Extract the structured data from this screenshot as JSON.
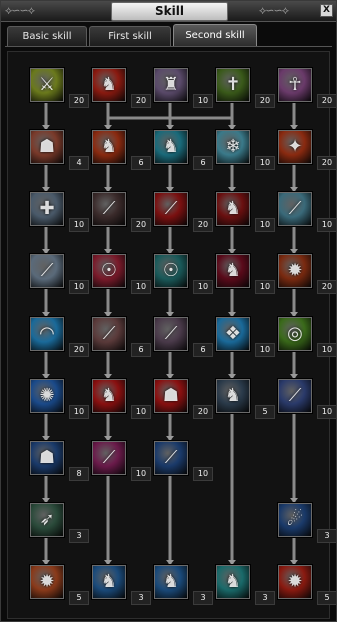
{
  "window": {
    "title": "Skill",
    "close_label": "X"
  },
  "tabs": [
    {
      "label": "Basic skill",
      "active": false
    },
    {
      "label": "First skill",
      "active": false
    },
    {
      "label": "Second skill",
      "active": true
    }
  ],
  "skills": [
    {
      "id": "r1c1",
      "level": "20",
      "icon": "golden-sword-icon",
      "color": "#6b7a1c"
    },
    {
      "id": "r1c2",
      "level": "20",
      "icon": "red-beast-icon",
      "color": "#8a1a10"
    },
    {
      "id": "r1c3",
      "level": "10",
      "icon": "armored-knight-icon",
      "color": "#5a4a6a"
    },
    {
      "id": "r1c4",
      "level": "20",
      "icon": "holy-cross-icon",
      "color": "#3a5a1a"
    },
    {
      "id": "r1c5",
      "level": "20",
      "icon": "robed-priest-icon",
      "color": "#6a3a6a"
    },
    {
      "id": "r2c1",
      "level": "4",
      "icon": "flesh-golem-icon",
      "color": "#7a3a2a"
    },
    {
      "id": "r2c2",
      "level": "6",
      "icon": "dragon-head-icon",
      "color": "#8a2a10"
    },
    {
      "id": "r2c3",
      "level": "6",
      "icon": "teal-wolf-icon",
      "color": "#1a6a7a"
    },
    {
      "id": "r2c4",
      "level": "10",
      "icon": "ice-beast-icon",
      "color": "#3a7a8a"
    },
    {
      "id": "r2c5",
      "level": "20",
      "icon": "flame-wing-icon",
      "color": "#8a2a10"
    },
    {
      "id": "r3c1",
      "level": "10",
      "icon": "cross-blade-icon",
      "color": "#4a5a6a"
    },
    {
      "id": "r3c2",
      "level": "20",
      "icon": "dark-claw-icon",
      "color": "#3a2a2a"
    },
    {
      "id": "r3c3",
      "level": "20",
      "icon": "red-claw-icon",
      "color": "#7a1010"
    },
    {
      "id": "r3c4",
      "level": "10",
      "icon": "red-beast-icon",
      "color": "#6a1010"
    },
    {
      "id": "r3c5",
      "level": "10",
      "icon": "ice-claw-icon",
      "color": "#3a6a7a"
    },
    {
      "id": "r4c1",
      "level": "10",
      "icon": "steel-blade-icon",
      "color": "#5a6a7a"
    },
    {
      "id": "r4c2",
      "level": "10",
      "icon": "fire-spirit-icon",
      "color": "#7a1a2a"
    },
    {
      "id": "r4c3",
      "level": "10",
      "icon": "teal-spirit-icon",
      "color": "#1a5a5a"
    },
    {
      "id": "r4c4",
      "level": "10",
      "icon": "crimson-wolf-icon",
      "color": "#5a0a1a"
    },
    {
      "id": "r4c5",
      "level": "20",
      "icon": "fire-dragon-icon",
      "color": "#7a2a10"
    },
    {
      "id": "r5c1",
      "level": "20",
      "icon": "blue-arc-icon",
      "color": "#1a6a9a"
    },
    {
      "id": "r5c2",
      "level": "6",
      "icon": "crimson-claw-icon",
      "color": "#5a3a3a"
    },
    {
      "id": "r5c3",
      "level": "6",
      "icon": "azure-claw-icon",
      "color": "#4a3a4a"
    },
    {
      "id": "r5c4",
      "level": "10",
      "icon": "ice-shard-icon",
      "color": "#1a6a9a"
    },
    {
      "id": "r5c5",
      "level": "10",
      "icon": "green-vortex-icon",
      "color": "#3a6a1a"
    },
    {
      "id": "r6c1",
      "level": "10",
      "icon": "blue-rune-icon",
      "color": "#1a4a8a"
    },
    {
      "id": "r6c2",
      "level": "10",
      "icon": "blood-dragon-icon",
      "color": "#8a1010"
    },
    {
      "id": "r6c3",
      "level": "20",
      "icon": "demon-mask-icon",
      "color": "#8a1010"
    },
    {
      "id": "r6c4",
      "level": "5",
      "icon": "shadow-wolf-icon",
      "color": "#2a3a4a"
    },
    {
      "id": "r6c5",
      "level": "10",
      "icon": "light-slash-icon",
      "color": "#2a3a6a"
    },
    {
      "id": "r7c1",
      "level": "8",
      "icon": "blue-warrior-icon",
      "color": "#1a3a6a"
    },
    {
      "id": "r7c2",
      "level": "10",
      "icon": "pink-slash-icon",
      "color": "#6a1a4a"
    },
    {
      "id": "r7c3",
      "level": "10",
      "icon": "blue-slash-icon",
      "color": "#1a3a6a"
    },
    {
      "id": "r8c1",
      "level": "3",
      "icon": "green-spear-icon",
      "color": "#2a4a3a"
    },
    {
      "id": "r8c5",
      "level": "3",
      "icon": "comet-icon",
      "color": "#1a3a6a"
    },
    {
      "id": "r9c1",
      "level": "5",
      "icon": "flame-warrior-icon",
      "color": "#8a3a1a"
    },
    {
      "id": "r9c2",
      "level": "3",
      "icon": "blue-dragon-icon",
      "color": "#1a4a7a"
    },
    {
      "id": "r9c3",
      "level": "3",
      "icon": "azure-dragon-icon",
      "color": "#1a4a7a"
    },
    {
      "id": "r9c4",
      "level": "3",
      "icon": "teal-dragon-icon",
      "color": "#1a6a6a"
    },
    {
      "id": "r9c5",
      "level": "5",
      "icon": "fire-wyrm-icon",
      "color": "#8a1a10"
    }
  ]
}
